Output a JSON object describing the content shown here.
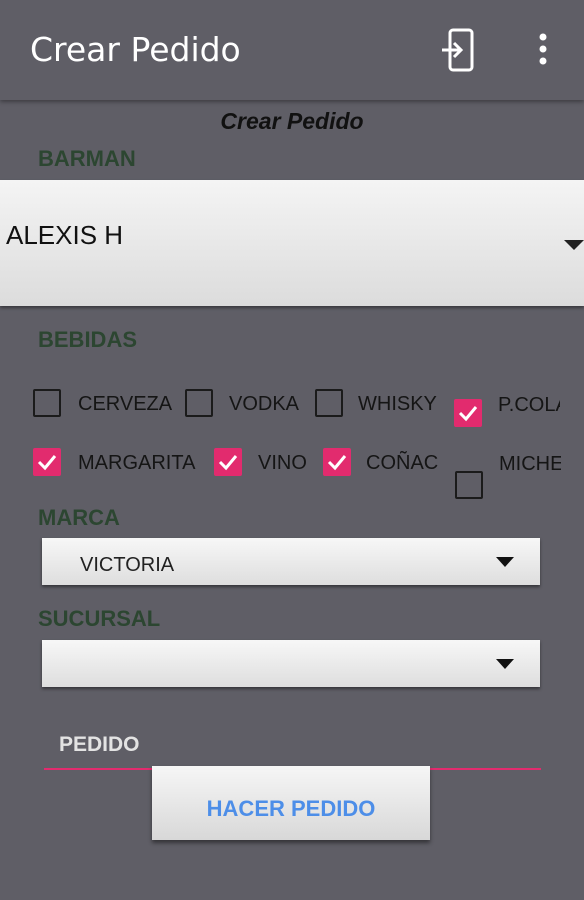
{
  "appbar": {
    "title": "Crear Pedido",
    "icons": [
      "login-icon",
      "more-vert-icon"
    ]
  },
  "form": {
    "heading": "Crear Pedido",
    "barman": {
      "label": "BARMAN",
      "selected": "ALEXIS H"
    },
    "bebidas": {
      "label": "BEBIDAS",
      "items": [
        {
          "label": "CERVEZA",
          "checked": false
        },
        {
          "label": "VODKA",
          "checked": false
        },
        {
          "label": "WHISKY",
          "checked": false
        },
        {
          "label": "P.COLADA",
          "checked": true
        },
        {
          "label": "MARGARITA",
          "checked": true
        },
        {
          "label": "VINO",
          "checked": true
        },
        {
          "label": "COÑAC",
          "checked": true
        },
        {
          "label": "MICHELADA",
          "checked": false
        }
      ]
    },
    "marca": {
      "label": "MARCA",
      "selected": "VICTORIA"
    },
    "sucursal": {
      "label": "SUCURSAL",
      "selected": ""
    },
    "pedido": {
      "placeholder": "PEDIDO",
      "value": ""
    },
    "submit_label": "HACER PEDIDO"
  },
  "colors": {
    "background": "#5f5e66",
    "accent": "#e22b6e",
    "section_label": "#2c4631",
    "button_text": "#4d8ee8"
  }
}
